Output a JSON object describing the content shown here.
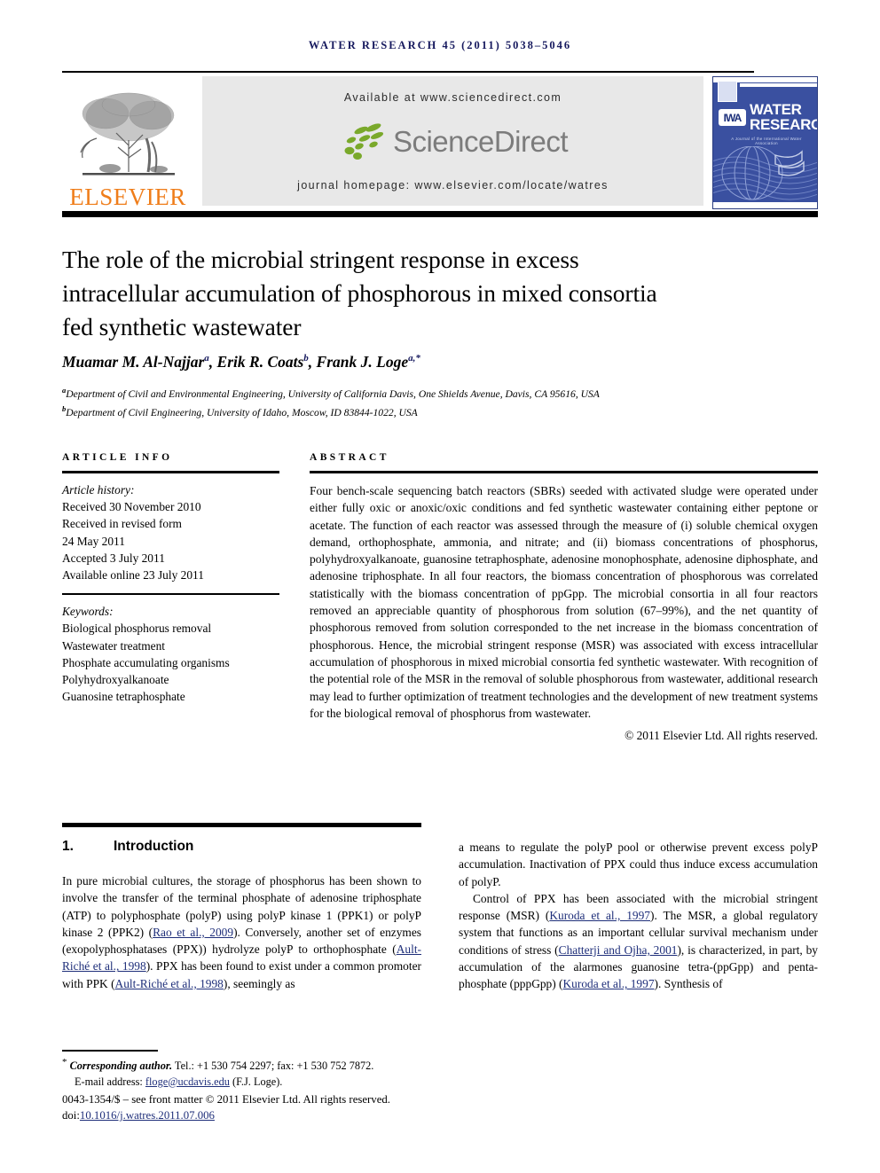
{
  "running_head": "WATER RESEARCH 45 (2011) 5038–5046",
  "masthead": {
    "elsevier_wordmark": "ELSEVIER",
    "elsevier_tree_icon": "elsevier-tree-icon",
    "available_at": "Available at www.sciencedirect.com",
    "sciencedirect_wordmark": "ScienceDirect",
    "sciencedirect_leaves_icon": "sciencedirect-leaves-icon",
    "journal_homepage": "journal homepage: www.elsevier.com/locate/watres",
    "cover": {
      "title_line1": "WATER",
      "title_line2": "RESEARCH",
      "iwa_logo_text": "IWA",
      "subtitle": "A Journal of the International Water Association"
    }
  },
  "title": "The role of the microbial stringent response in excess intracellular accumulation of phosphorous in mixed consortia fed synthetic wastewater",
  "authors": [
    {
      "name": "Muamar M. Al-Najjar",
      "marks": "a"
    },
    {
      "name": "Erik R. Coats",
      "marks": "b"
    },
    {
      "name": "Frank J. Loge",
      "marks": "a,*"
    }
  ],
  "affiliations": [
    {
      "mark": "a",
      "text": "Department of Civil and Environmental Engineering, University of California Davis, One Shields Avenue, Davis, CA 95616, USA"
    },
    {
      "mark": "b",
      "text": "Department of Civil Engineering, University of Idaho, Moscow, ID 83844-1022, USA"
    }
  ],
  "article_info": {
    "heading": "ARTICLE INFO",
    "history_label": "Article history:",
    "history": [
      "Received 30 November 2010",
      "Received in revised form",
      "24 May 2011",
      "Accepted 3 July 2011",
      "Available online 23 July 2011"
    ],
    "keywords_label": "Keywords:",
    "keywords": [
      "Biological phosphorus removal",
      "Wastewater treatment",
      "Phosphate accumulating organisms",
      "Polyhydroxyalkanoate",
      "Guanosine tetraphosphate"
    ]
  },
  "abstract": {
    "heading": "ABSTRACT",
    "text": "Four bench-scale sequencing batch reactors (SBRs) seeded with activated sludge were operated under either fully oxic or anoxic/oxic conditions and fed synthetic wastewater containing either peptone or acetate. The function of each reactor was assessed through the measure of (i) soluble chemical oxygen demand, orthophosphate, ammonia, and nitrate; and (ii) biomass concentrations of phosphorus, polyhydroxyalkanoate, guanosine tetraphosphate, adenosine monophosphate, adenosine diphosphate, and adenosine triphosphate. In all four reactors, the biomass concentration of phosphorous was correlated statistically with the biomass concentration of ppGpp. The microbial consortia in all four reactors removed an appreciable quantity of phosphorous from solution (67–99%), and the net quantity of phosphorous removed from solution corresponded to the net increase in the biomass concentration of phosphorous. Hence, the microbial stringent response (MSR) was associated with excess intracellular accumulation of phosphorous in mixed microbial consortia fed synthetic wastewater. With recognition of the potential role of the MSR in the removal of soluble phosphorous from wastewater, additional research may lead to further optimization of treatment technologies and the development of new treatment systems for the biological removal of phosphorus from wastewater.",
    "copyright": "© 2011 Elsevier Ltd. All rights reserved."
  },
  "introduction": {
    "number": "1.",
    "heading": "Introduction",
    "left_paragraphs": [
      {
        "runs": [
          {
            "t": "In pure microbial cultures, the storage of phosphorus has been shown to involve the transfer of the terminal phosphate of adenosine triphosphate (ATP) to polyphosphate (polyP) using polyP kinase 1 (PPK1) or polyP kinase 2 (PPK2) (",
            "cite": false
          },
          {
            "t": "Rao et al., 2009",
            "cite": true
          },
          {
            "t": "). Conversely, another set of enzymes (exopolyphosphatases (PPX)) hydrolyze polyP to orthophosphate (",
            "cite": false
          },
          {
            "t": "Ault-Riché et al., 1998",
            "cite": true
          },
          {
            "t": "). PPX has been found to exist under a common promoter with PPK (",
            "cite": false
          },
          {
            "t": "Ault-Riché et al., 1998",
            "cite": true
          },
          {
            "t": "), seemingly as",
            "cite": false
          }
        ]
      }
    ],
    "right_paragraphs": [
      {
        "indent": false,
        "runs": [
          {
            "t": "a means to regulate the polyP pool or otherwise prevent excess polyP accumulation. Inactivation of PPX could thus induce excess accumulation of polyP.",
            "cite": false
          }
        ]
      },
      {
        "indent": true,
        "runs": [
          {
            "t": "Control of PPX has been associated with the microbial stringent response (MSR) (",
            "cite": false
          },
          {
            "t": "Kuroda et al., 1997",
            "cite": true
          },
          {
            "t": "). The MSR, a global regulatory system that functions as an important cellular survival mechanism under conditions of stress (",
            "cite": false
          },
          {
            "t": "Chatterji and Ojha, 2001",
            "cite": true
          },
          {
            "t": "), is characterized, in part, by accumulation of the alarmones guanosine tetra-(ppGpp) and penta-phosphate (pppGpp) (",
            "cite": false
          },
          {
            "t": "Kuroda et al., 1997",
            "cite": true
          },
          {
            "t": "). Synthesis of",
            "cite": false
          }
        ]
      }
    ]
  },
  "footnote": {
    "star": "*",
    "corresponding_label": "Corresponding author.",
    "contact": " Tel.: +1 530 754 2297; fax: +1 530 752 7872.",
    "email_label": "E-mail address:",
    "email": "floge@ucdavis.edu",
    "email_suffix": " (F.J. Loge).",
    "issn_line_pre": "0043-1354/$ – see front matter © 2011 Elsevier Ltd. All rights reserved.",
    "doi_label": "doi:",
    "doi": "10.1016/j.watres.2011.07.006"
  },
  "colors": {
    "running_head": "#16195e",
    "citation_link": "#1f2f7a",
    "elsevier_orange": "#ef7d1a",
    "sciencedirect_gray": "#7c7c7c",
    "sciencedirect_green": "#7aa92b",
    "banner_bg": "#e8e8e8",
    "cover_blue": "#3a50a0"
  }
}
